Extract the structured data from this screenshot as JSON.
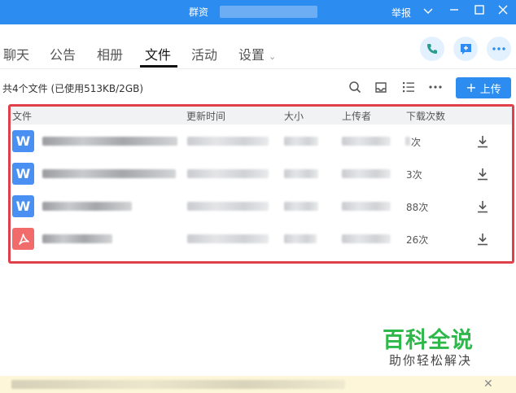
{
  "window": {
    "title": "群资",
    "report": "举报"
  },
  "tabs": [
    {
      "label": "聊天"
    },
    {
      "label": "公告"
    },
    {
      "label": "相册"
    },
    {
      "label": "文件"
    },
    {
      "label": "活动"
    },
    {
      "label": "设置"
    }
  ],
  "toolbar": {
    "file_count": "共4个文件 (已使用513KB/2GB)",
    "upload_label": "上传"
  },
  "table": {
    "headers": [
      "文件",
      "更新时间",
      "大小",
      "上传者",
      "下载次数"
    ],
    "rows": [
      {
        "type": "word",
        "icon": "W",
        "downloads": "次"
      },
      {
        "type": "word",
        "icon": "W",
        "downloads": "3次"
      },
      {
        "type": "word",
        "icon": "W",
        "downloads": "88次"
      },
      {
        "type": "pdf",
        "icon": "pdf",
        "downloads": "26次"
      }
    ]
  },
  "watermark": {
    "title": "百科全说",
    "subtitle": "助你轻松解决"
  },
  "colors": {
    "accent": "#2d8cf0",
    "highlight": "#e0404a",
    "word": "#4a8ff2",
    "pdf": "#f26b6b",
    "brand_green": "#2eb84a"
  }
}
